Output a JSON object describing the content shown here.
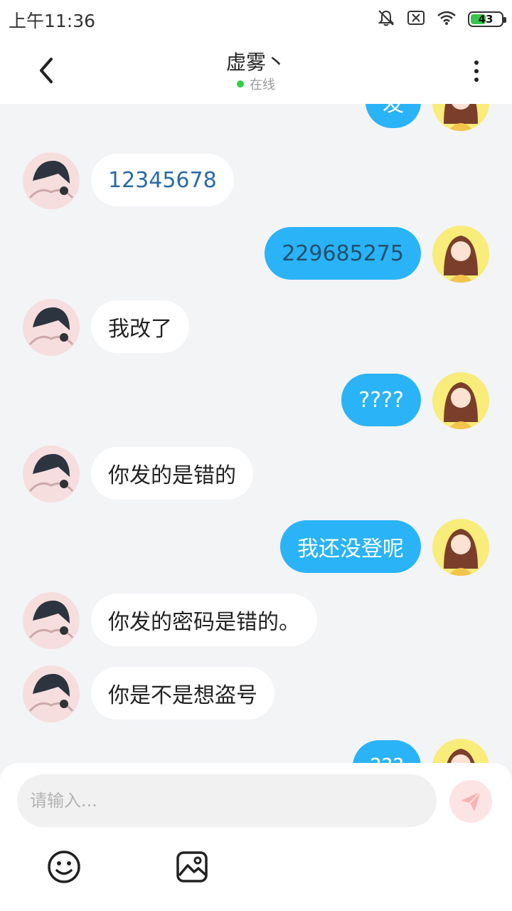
{
  "status_bar": {
    "time": "上午11:36",
    "battery": "43"
  },
  "header": {
    "title": "虚雾丶",
    "status_text": "在线"
  },
  "messages": [
    {
      "side": "right",
      "text": "发"
    },
    {
      "side": "left",
      "text": "12345678"
    },
    {
      "side": "right",
      "text": "229685275"
    },
    {
      "side": "left",
      "text": "我改了"
    },
    {
      "side": "right",
      "text": "????"
    },
    {
      "side": "left",
      "text": "你发的是错的"
    },
    {
      "side": "right",
      "text": "我还没登呢"
    },
    {
      "side": "left",
      "text": "你发的密码是错的。"
    },
    {
      "side": "left",
      "text": "你是不是想盗号"
    },
    {
      "side": "right",
      "text": "???"
    }
  ],
  "input": {
    "placeholder": "请输入..."
  },
  "colors": {
    "sent_bubble": "#2ab3f7",
    "received_bubble": "#ffffff",
    "online_dot": "#2fcf46",
    "send_button": "#fde4e4",
    "background": "#f3f4f6"
  },
  "icons": {
    "back": "chevron-left-icon",
    "more": "more-vertical-icon",
    "send": "paper-plane-icon",
    "emoji": "smiley-icon",
    "image": "image-icon",
    "mute": "bell-off-icon",
    "sim": "no-sim-icon",
    "wifi": "wifi-icon"
  }
}
